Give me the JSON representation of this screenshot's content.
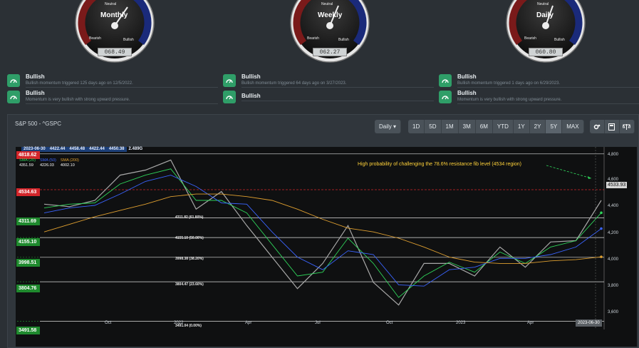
{
  "gauges": [
    {
      "label": "Monthly",
      "neutral": "Neutral",
      "bearish": "Bearish",
      "bullish": "Bullish",
      "value": "068.49"
    },
    {
      "label": "Weekly",
      "neutral": "Neutral",
      "bearish": "Bearish",
      "bullish": "Bullish",
      "value": "062.27"
    },
    {
      "label": "Daily",
      "neutral": "Neutral",
      "bearish": "Bearish",
      "bullish": "Bullish",
      "value": "060.80"
    }
  ],
  "signals": [
    [
      {
        "title": "Bullish",
        "desc": "Bullish momentum triggered 125 days ago on 12/5/2022."
      },
      {
        "title": "Bullish",
        "desc": "Momentum is very bullish with strong upward pressure."
      }
    ],
    [
      {
        "title": "Bullish",
        "desc": "Bullish momentum triggered 64 days ago on 3/27/2023."
      },
      {
        "title": "Bullish",
        "desc": ""
      }
    ],
    [
      {
        "title": "Bullish",
        "desc": "Bullish momentum triggered 1 days ago on 6/29/2023."
      },
      {
        "title": "Bullish",
        "desc": "Momentum is very bullish with strong upward pressure."
      }
    ]
  ],
  "chart": {
    "title": "S&P 500 - ^GSPC",
    "interval": "Daily",
    "ranges": [
      "1D",
      "5D",
      "1M",
      "3M",
      "6M",
      "YTD",
      "1Y",
      "2Y",
      "5Y",
      "MAX"
    ],
    "active_ranges": [
      "5Y"
    ],
    "stats": {
      "date": "2023-06-30",
      "open": "4422.44",
      "high": "4458.48",
      "low": "4422.44",
      "close": "4450.38",
      "volume": "2.489G"
    },
    "sma": [
      {
        "name": "SMA (20)",
        "value": "4351.59",
        "color": "#2fd45a"
      },
      {
        "name": "SMA (50)",
        "value": "4226.03",
        "color": "#3a64ff"
      },
      {
        "name": "SMA (200)",
        "value": "4002.10",
        "color": "#e0a030"
      }
    ],
    "top_tag": "4818.62",
    "resistance_tag": "4534.63",
    "price_tag": "4533.93",
    "date_tag": "2023-06-30",
    "annotation": "High probability of challenging the 78.6% resistance fib level (4534 region)",
    "fib_tags": [
      "4311.69",
      "4155.10",
      "3998.51",
      "3804.76",
      "3491.58"
    ],
    "fib_labels": [
      "4311.82 (61.80%)",
      "4155.10 (50.00%)",
      "3998.38 (38.20%)",
      "3804.47 (23.60%)",
      "3491.04 (0.00%)"
    ],
    "y_ticks": [
      "4,800",
      "4,600",
      "4,400",
      "4,200",
      "4,000",
      "3,800",
      "3,600"
    ],
    "x_ticks": [
      "Oct",
      "2022",
      "Apr",
      "Jul",
      "Oct",
      "2023",
      "Apr"
    ]
  },
  "chart_data": {
    "type": "line",
    "title": "S&P 500 - ^GSPC",
    "xlabel": "",
    "ylabel": "",
    "ylim": [
      3460,
      4840
    ],
    "x": [
      "2021-08",
      "2021-09",
      "2021-10",
      "2021-11",
      "2021-12",
      "2022-01",
      "2022-02",
      "2022-03",
      "2022-04",
      "2022-05",
      "2022-06",
      "2022-07",
      "2022-08",
      "2022-09",
      "2022-10",
      "2022-11",
      "2022-12",
      "2023-01",
      "2023-02",
      "2023-03",
      "2023-04",
      "2023-05",
      "2023-06"
    ],
    "series": [
      {
        "name": "S&P 500 - ^GSPC",
        "values": [
          4420,
          4400,
          4450,
          4650,
          4690,
          4770,
          4380,
          4520,
          4250,
          4000,
          3750,
          3950,
          4250,
          3800,
          3620,
          3950,
          3950,
          3850,
          4080,
          3920,
          4120,
          4130,
          4450
        ]
      },
      {
        "name": "SMA (20)",
        "values": [
          4390,
          4420,
          4430,
          4580,
          4650,
          4700,
          4450,
          4450,
          4350,
          4100,
          3850,
          3880,
          4150,
          3950,
          3680,
          3850,
          3960,
          3880,
          4040,
          3950,
          4080,
          4130,
          4351.59
        ]
      },
      {
        "name": "SMA (50)",
        "values": [
          4350,
          4390,
          4410,
          4500,
          4600,
          4650,
          4560,
          4430,
          4420,
          4200,
          4000,
          3900,
          4050,
          4020,
          3780,
          3770,
          3900,
          3920,
          3990,
          3990,
          4020,
          4080,
          4226.03
        ]
      },
      {
        "name": "SMA (200)",
        "values": [
          4200,
          4260,
          4320,
          4370,
          4420,
          4480,
          4500,
          4500,
          4480,
          4450,
          4380,
          4300,
          4230,
          4200,
          4150,
          4080,
          4000,
          3960,
          3950,
          3950,
          3970,
          3980,
          4002.1
        ]
      }
    ],
    "hlines": [
      4818.62,
      4534.63,
      4311.82,
      4155.1,
      3998.38,
      3804.47,
      3491.04
    ],
    "grid": false
  }
}
